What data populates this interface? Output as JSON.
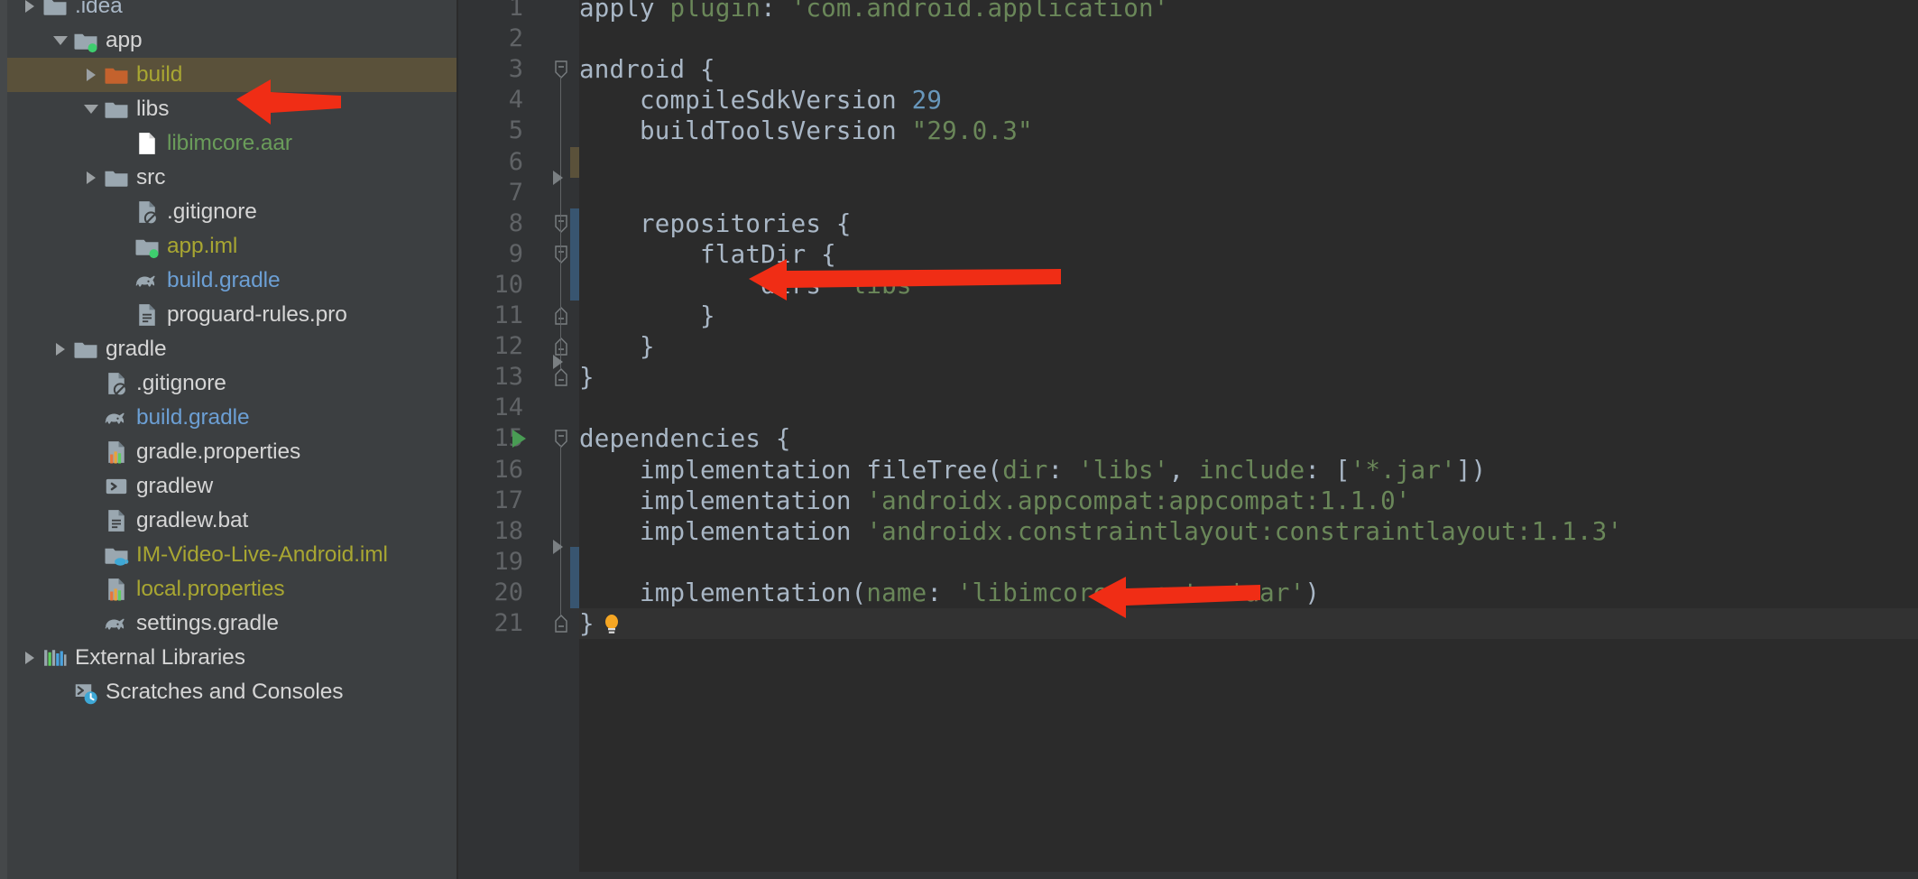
{
  "sidebar": {
    "name": "project-tree",
    "items": [
      {
        "label": ".idea",
        "icon": "folder-icon",
        "indent": 0,
        "arrow": "collapsed",
        "color": "#a9b7c6",
        "partial": true
      },
      {
        "label": "app",
        "icon": "module-folder-icon",
        "indent": 1,
        "arrow": "expanded",
        "color": "#d5d5d5"
      },
      {
        "label": "build",
        "icon": "excluded-folder-icon",
        "indent": 2,
        "arrow": "collapsed",
        "color": "#a8a632",
        "selected": true
      },
      {
        "label": "libs",
        "icon": "folder-icon",
        "indent": 2,
        "arrow": "expanded",
        "color": "#d5d5d5"
      },
      {
        "label": "libimcore.aar",
        "icon": "file-icon",
        "indent": 3,
        "arrow": "none",
        "color": "#6a9c5a"
      },
      {
        "label": "src",
        "icon": "folder-icon",
        "indent": 2,
        "arrow": "collapsed",
        "color": "#d5d5d5"
      },
      {
        "label": ".gitignore",
        "icon": "gitignore-file-icon",
        "indent": 3,
        "arrow": "none",
        "color": "#d5d5d5"
      },
      {
        "label": "app.iml",
        "icon": "module-folder-icon",
        "indent": 3,
        "arrow": "none",
        "color": "#a8a632"
      },
      {
        "label": "build.gradle",
        "icon": "gradle-icon",
        "indent": 3,
        "arrow": "none",
        "color": "#6c9fd4"
      },
      {
        "label": "proguard-rules.pro",
        "icon": "text-file-icon",
        "indent": 3,
        "arrow": "none",
        "color": "#d5d5d5"
      },
      {
        "label": "gradle",
        "icon": "folder-icon",
        "indent": 1,
        "arrow": "collapsed",
        "color": "#d5d5d5"
      },
      {
        "label": ".gitignore",
        "icon": "gitignore-file-icon",
        "indent": 2,
        "arrow": "none",
        "color": "#d5d5d5"
      },
      {
        "label": "build.gradle",
        "icon": "gradle-icon",
        "indent": 2,
        "arrow": "none",
        "color": "#6c9fd4"
      },
      {
        "label": "gradle.properties",
        "icon": "properties-file-icon",
        "indent": 2,
        "arrow": "none",
        "color": "#d5d5d5"
      },
      {
        "label": "gradlew",
        "icon": "shell-script-icon",
        "indent": 2,
        "arrow": "none",
        "color": "#d5d5d5"
      },
      {
        "label": "gradlew.bat",
        "icon": "text-file-icon",
        "indent": 2,
        "arrow": "none",
        "color": "#d5d5d5"
      },
      {
        "label": "IM-Video-Live-Android.iml",
        "icon": "java-module-icon",
        "indent": 2,
        "arrow": "none",
        "color": "#a8a632"
      },
      {
        "label": "local.properties",
        "icon": "properties-file-icon",
        "indent": 2,
        "arrow": "none",
        "color": "#a8a632"
      },
      {
        "label": "settings.gradle",
        "icon": "gradle-icon",
        "indent": 2,
        "arrow": "none",
        "color": "#d5d5d5"
      },
      {
        "label": "External Libraries",
        "icon": "libraries-icon",
        "indent": 0,
        "arrow": "collapsed",
        "color": "#d5d5d5"
      },
      {
        "label": "Scratches and Consoles",
        "icon": "scratches-icon",
        "indent": 1,
        "arrow": "none",
        "color": "#d5d5d5"
      }
    ]
  },
  "editor": {
    "name": "build-gradle-editor",
    "language": "Groovy",
    "first_visible_line": 1,
    "lines": [
      {
        "n": "1",
        "tokens": [
          {
            "t": "apply ",
            "c": "pln"
          },
          {
            "t": "plugin",
            "c": "nmarg"
          },
          {
            "t": ": ",
            "c": "pln"
          },
          {
            "t": "'com.android.application'",
            "c": "str"
          }
        ]
      },
      {
        "n": "2",
        "tokens": []
      },
      {
        "n": "3",
        "tokens": [
          {
            "t": "android {",
            "c": "pln"
          }
        ],
        "fold": "start"
      },
      {
        "n": "4",
        "tokens": [
          {
            "t": "    compileSdkVersion ",
            "c": "pln"
          },
          {
            "t": "29",
            "c": "num"
          }
        ]
      },
      {
        "n": "5",
        "tokens": [
          {
            "t": "    buildToolsVersion ",
            "c": "pln"
          },
          {
            "t": "\"29.0.3\"",
            "c": "str"
          }
        ]
      },
      {
        "n": "6",
        "tokens": []
      },
      {
        "n": "7",
        "tokens": []
      },
      {
        "n": "8",
        "tokens": [
          {
            "t": "    repositories {",
            "c": "pln"
          }
        ],
        "fold": "start"
      },
      {
        "n": "9",
        "tokens": [
          {
            "t": "        flatDir {",
            "c": "pln"
          }
        ],
        "fold": "start"
      },
      {
        "n": "10",
        "tokens": [
          {
            "t": "            dirs ",
            "c": "pln"
          },
          {
            "t": "'libs'",
            "c": "str"
          }
        ]
      },
      {
        "n": "11",
        "tokens": [
          {
            "t": "        }",
            "c": "pln"
          }
        ],
        "fold": "end"
      },
      {
        "n": "12",
        "tokens": [
          {
            "t": "    }",
            "c": "pln"
          }
        ],
        "fold": "end"
      },
      {
        "n": "13",
        "tokens": [
          {
            "t": "}",
            "c": "pln"
          }
        ],
        "fold": "end"
      },
      {
        "n": "14",
        "tokens": []
      },
      {
        "n": "15",
        "tokens": [
          {
            "t": "dependencies {",
            "c": "pln"
          }
        ],
        "fold": "start",
        "run": true
      },
      {
        "n": "16",
        "tokens": [
          {
            "t": "    implementation fileTree(",
            "c": "pln"
          },
          {
            "t": "dir",
            "c": "nmarg"
          },
          {
            "t": ": ",
            "c": "pln"
          },
          {
            "t": "'libs'",
            "c": "str"
          },
          {
            "t": ", ",
            "c": "pln"
          },
          {
            "t": "include",
            "c": "nmarg"
          },
          {
            "t": ": [",
            "c": "pln"
          },
          {
            "t": "'*.jar'",
            "c": "str"
          },
          {
            "t": "])",
            "c": "pln"
          }
        ]
      },
      {
        "n": "17",
        "tokens": [
          {
            "t": "    implementation ",
            "c": "pln"
          },
          {
            "t": "'androidx.appcompat:appcompat:1.1.0'",
            "c": "str"
          }
        ]
      },
      {
        "n": "18",
        "tokens": [
          {
            "t": "    implementation ",
            "c": "pln"
          },
          {
            "t": "'androidx.constraintlayout:constraintlayout:1.1.3'",
            "c": "str"
          }
        ]
      },
      {
        "n": "19",
        "tokens": []
      },
      {
        "n": "20",
        "tokens": [
          {
            "t": "    implementation(",
            "c": "pln"
          },
          {
            "t": "name",
            "c": "nmarg"
          },
          {
            "t": ": ",
            "c": "pln"
          },
          {
            "t": "'libimcore'",
            "c": "str"
          },
          {
            "t": ", ",
            "c": "pln"
          },
          {
            "t": "ext",
            "c": "nmarg"
          },
          {
            "t": ": ",
            "c": "pln"
          },
          {
            "t": "'aar'",
            "c": "str"
          },
          {
            "t": ")",
            "c": "pln"
          }
        ]
      },
      {
        "n": "21",
        "tokens": [
          {
            "t": "}",
            "c": "pln"
          }
        ],
        "fold": "end",
        "bulb": true,
        "caret": true
      }
    ]
  },
  "annotations": {
    "name": "red-arrow-annotations",
    "arrows": [
      {
        "id": "arrow-libimcore-aar",
        "points_at": "libimcore.aar"
      },
      {
        "id": "arrow-dirs-libs",
        "points_at": "dirs 'libs'"
      },
      {
        "id": "arrow-implementation-libimcore",
        "points_at": "implementation(name: 'libimcore', ext: 'aar')"
      }
    ],
    "color": "#f02d15"
  },
  "colors": {
    "sidebar_bg": "#3c3f41",
    "editor_bg": "#2b2b2b",
    "gutter_bg": "#313335",
    "selection_bg": "#5a513a",
    "default_text": "#a9b7c6",
    "string": "#6a8759",
    "number": "#6897bb",
    "named_arg": "#6a8759",
    "line_number": "#606366",
    "run_arrow": "#499c54",
    "annotation_red": "#f02d15"
  }
}
